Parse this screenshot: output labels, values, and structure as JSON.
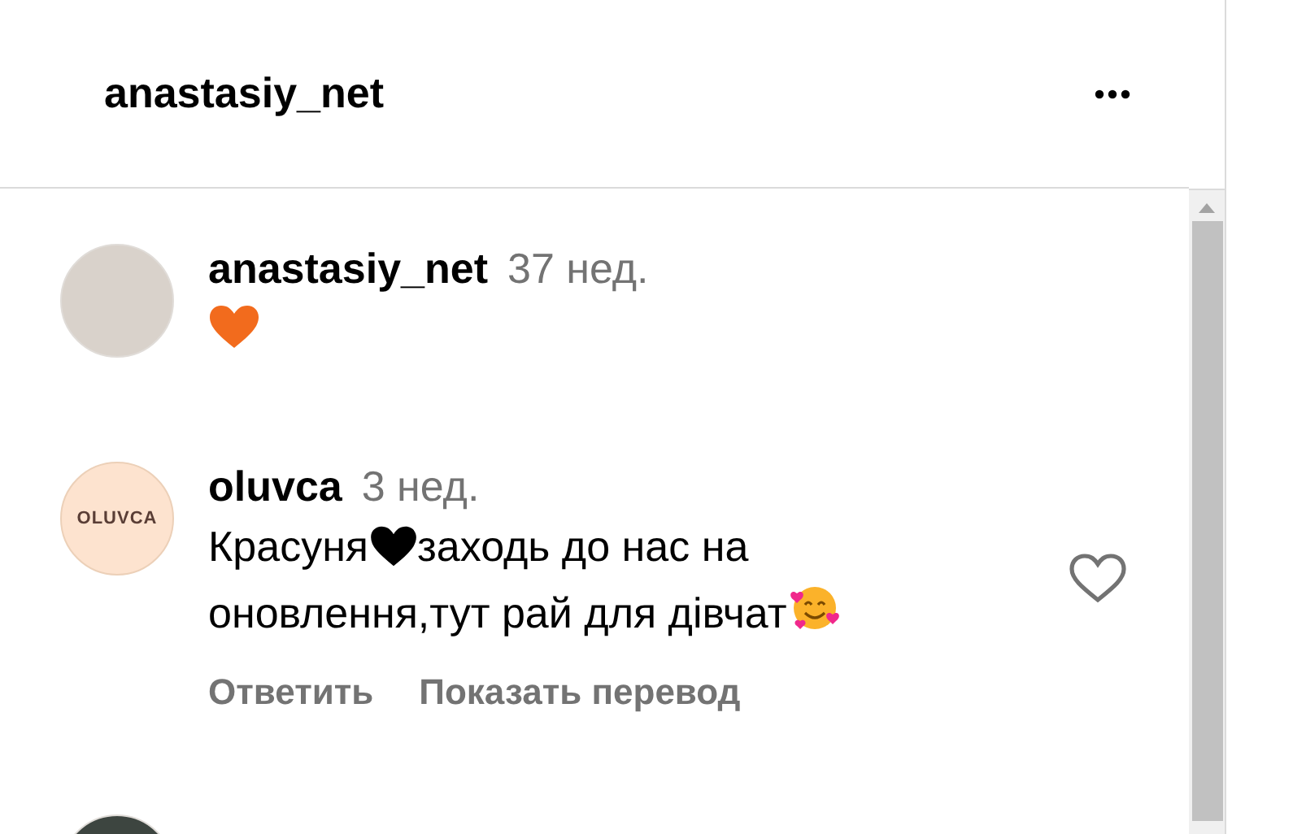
{
  "header": {
    "title": "anastasiy_net"
  },
  "comments": [
    {
      "avatar": {
        "kind": "photo"
      },
      "username": "anastasiy_net",
      "time": "37 нед.",
      "body": [
        {
          "kind": "orange-heart"
        }
      ],
      "like": false
    },
    {
      "avatar": {
        "kind": "logo",
        "text": "OLUVCA"
      },
      "username": "oluvca",
      "time": "3 нед.",
      "body": [
        {
          "kind": "text",
          "text": "Красуня"
        },
        {
          "kind": "black-heart"
        },
        {
          "kind": "text",
          "text": "заходь до нас на оновлення,тут рай для дівчат"
        },
        {
          "kind": "smile-hearts"
        }
      ],
      "actions": [
        "Ответить",
        "Показать перевод"
      ],
      "like": true
    },
    {
      "avatar": {
        "kind": "dark-photo"
      }
    }
  ]
}
